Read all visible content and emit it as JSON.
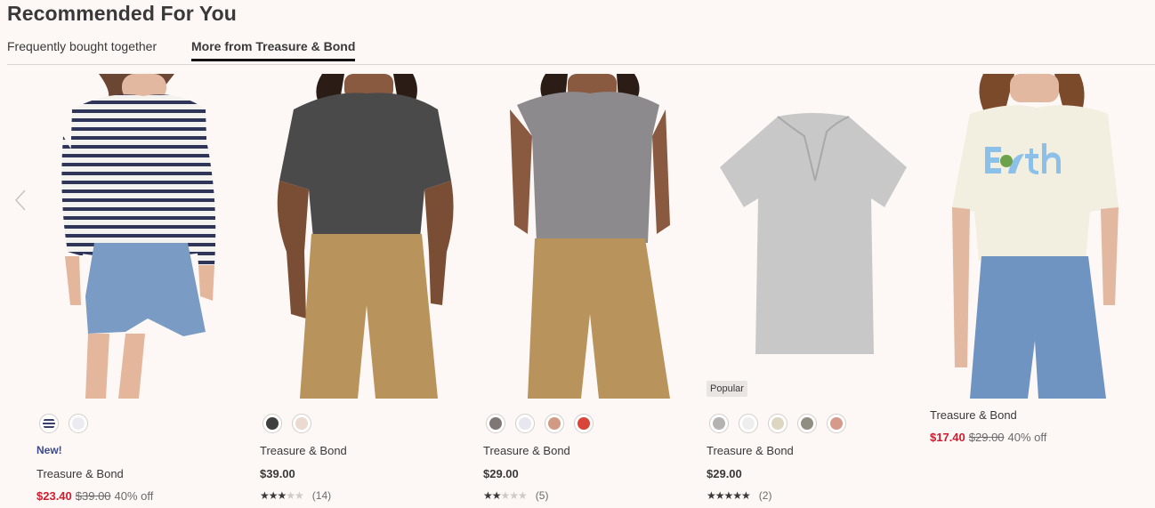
{
  "section": {
    "title": "Recommended For You",
    "tabs": [
      {
        "label": "Frequently bought together"
      },
      {
        "label": "More from Treasure & Bond"
      }
    ]
  },
  "products": [
    {
      "brand": "Treasure & Bond",
      "new_label": "New!",
      "sale_price": "$23.40",
      "original_price": "$39.00",
      "discount": "40% off",
      "swatch_colors": [
        "stripe",
        "#ecebf2"
      ]
    },
    {
      "brand": "Treasure & Bond",
      "price": "$39.00",
      "rating": 3.5,
      "stars": "★★★",
      "stars_dim": "★★",
      "review_count": "(14)",
      "swatch_colors": [
        "#3f3f3f",
        "#ecd9cf"
      ]
    },
    {
      "brand": "Treasure & Bond",
      "price": "$29.00",
      "rating": 2.5,
      "stars": "★★",
      "stars_dim": "★★★",
      "review_count": "(5)",
      "swatch_colors": [
        "#7d7775",
        "#e8e6ee",
        "#d29a84",
        "#d8453b"
      ]
    },
    {
      "brand": "Treasure & Bond",
      "badge": "Popular",
      "price": "$29.00",
      "rating": 5,
      "stars": "★★★★★",
      "stars_dim": "",
      "review_count": "(2)",
      "swatch_colors": [
        "#b5b3b2",
        "#eeeeee",
        "#ddd6c0",
        "#8f8e80",
        "#d59a89"
      ]
    },
    {
      "brand": "Treasure & Bond",
      "sale_price": "$17.40",
      "original_price": "$29.00",
      "discount": "40% off"
    }
  ],
  "icons": {
    "prev": "chevron-left-icon",
    "next": "chevron-right-icon"
  }
}
